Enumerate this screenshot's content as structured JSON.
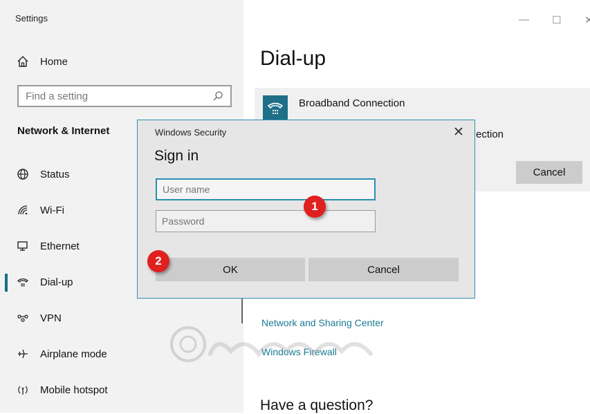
{
  "window": {
    "app_title": "Settings",
    "minimize_icon": "minimize-icon",
    "maximize_icon": "maximize-icon",
    "close_icon": "close-icon"
  },
  "sidebar": {
    "home_label": "Home",
    "search_placeholder": "Find a setting",
    "section_title": "Network & Internet",
    "items": [
      {
        "label": "Status",
        "icon": "globe-icon"
      },
      {
        "label": "Wi-Fi",
        "icon": "wifi-icon"
      },
      {
        "label": "Ethernet",
        "icon": "ethernet-icon"
      },
      {
        "label": "Dial-up",
        "icon": "phone-icon",
        "active": true
      },
      {
        "label": "VPN",
        "icon": "vpn-icon"
      },
      {
        "label": "Airplane mode",
        "icon": "airplane-icon"
      },
      {
        "label": "Mobile hotspot",
        "icon": "hotspot-icon"
      }
    ]
  },
  "main": {
    "title": "Dial-up",
    "connection_name": "Broadband Connection",
    "connection_partial_text": "ection",
    "cancel_label": "Cancel",
    "links": [
      "Network and Sharing Center",
      "Windows Firewall"
    ],
    "question": "Have a question?"
  },
  "dialog": {
    "caption": "Windows Security",
    "close_glyph": "✕",
    "heading": "Sign in",
    "username_placeholder": "User name",
    "password_placeholder": "Password",
    "ok_label": "OK",
    "cancel_label": "Cancel"
  },
  "badges": [
    "1",
    "2"
  ],
  "colors": {
    "accent": "#1f6f87",
    "link": "#1a7a93",
    "dialog_border": "#2a8fb1",
    "badge": "#e01f1f"
  }
}
